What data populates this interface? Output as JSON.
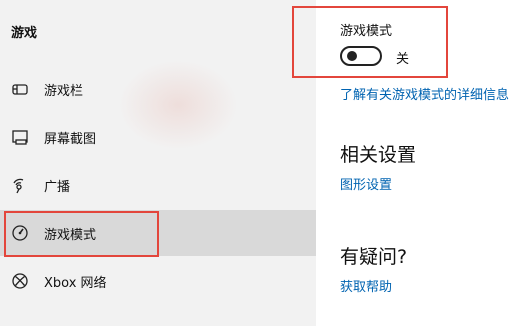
{
  "sidebar": {
    "title": "游戏",
    "items": [
      {
        "label": "游戏栏",
        "icon": "game-bar-icon"
      },
      {
        "label": "屏幕截图",
        "icon": "capture-icon"
      },
      {
        "label": "广播",
        "icon": "broadcast-icon"
      },
      {
        "label": "游戏模式",
        "icon": "game-mode-icon",
        "selected": true
      },
      {
        "label": "Xbox 网络",
        "icon": "xbox-icon"
      }
    ]
  },
  "game_mode": {
    "label": "游戏模式",
    "toggle_on": false,
    "toggle_state": "关",
    "learn_more_link": "了解有关游戏模式的详细信息"
  },
  "related_settings": {
    "heading": "相关设置",
    "graphics_link": "图形设置"
  },
  "help": {
    "heading": "有疑问?",
    "get_help_link": "获取帮助"
  },
  "colors": {
    "accent_link": "#0063b1",
    "highlight_box": "#e3463c",
    "sidebar_bg": "#f2f2f2",
    "selected_bg": "#d9d9d9"
  }
}
